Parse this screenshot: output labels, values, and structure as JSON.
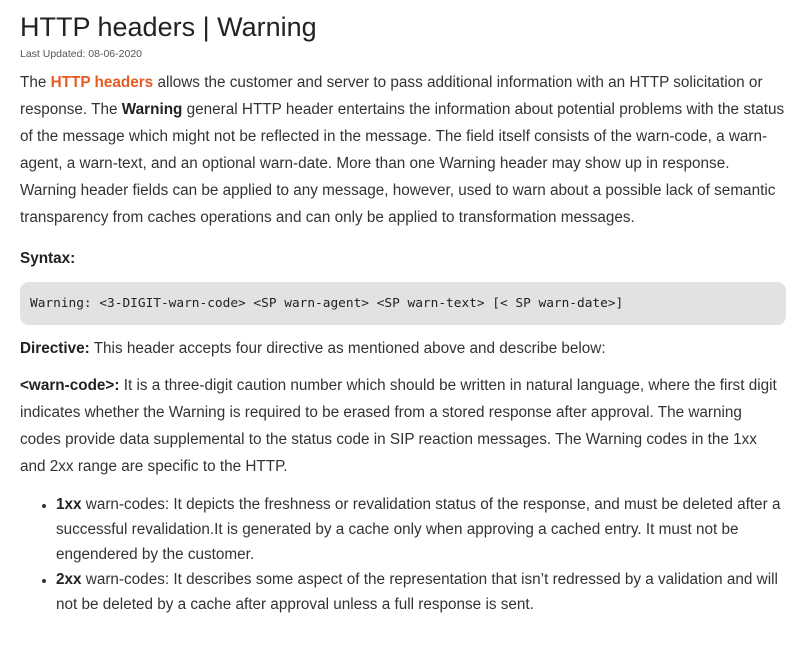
{
  "page": {
    "title": "HTTP headers | Warning",
    "last_updated": "Last Updated: 08-06-2020"
  },
  "intro": {
    "prefix": "The ",
    "link": "HTTP headers",
    "middle": " allows the customer and server to pass additional information with an HTTP solicitation or response. The ",
    "bold": "Warning",
    "suffix": " general HTTP header entertains the information about potential problems with the status of the message which might not be reflected in the message. The field itself consists of the warn-code, a warn-agent, a warn-text, and an optional warn-date. More than one Warning header may show up in response. Warning header fields can be applied to any message, however, used to warn about a possible lack of semantic transparency from caches operations and can only be applied to transformation messages."
  },
  "syntax": {
    "heading": "Syntax:",
    "code": "Warning: <3-DIGIT-warn-code> <SP warn-agent> <SP warn-text> [< SP warn-date>]"
  },
  "directive": {
    "label": "Directive:",
    "text": " This header accepts four directive as mentioned above and describe below:"
  },
  "warn_code": {
    "label": "<warn-code>:",
    "text": " It is a three-digit caution number which should be written in natural language, where the first digit indicates whether the Warning is required to be erased from a stored response after approval. The warning codes provide data supplemental to the status code in SIP reaction messages. The Warning codes in the 1xx and 2xx range are specific to the HTTP.",
    "items": [
      {
        "code": "1xx",
        "text": " warn-codes: It depicts the freshness or revalidation status of the response, and must be deleted after a successful revalidation.It is generated by a cache only when approving a cached entry. It must not be engendered by the customer."
      },
      {
        "code": "2xx",
        "text": " warn-codes: It describes some aspect of the representation that isn’t redressed by a validation and will not be deleted by a cache after approval unless a full response is sent."
      }
    ]
  },
  "colors": {
    "link": "#e45b22",
    "code_background": "#e2e2e2",
    "text": "#333333"
  }
}
